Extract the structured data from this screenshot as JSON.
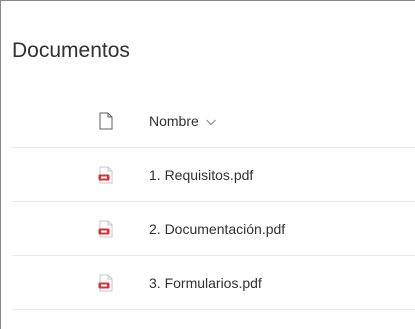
{
  "title": "Documentos",
  "header": {
    "file_type_icon": "document-icon",
    "name_label": "Nombre",
    "sort_icon": "chevron-down-icon"
  },
  "files": [
    {
      "name": "1. Requisitos.pdf",
      "icon": "pdf-icon"
    },
    {
      "name": "2. Documentación.pdf",
      "icon": "pdf-icon"
    },
    {
      "name": "3. Formularios.pdf",
      "icon": "pdf-icon"
    }
  ],
  "colors": {
    "pdf_red": "#d13438",
    "text": "#323130",
    "divider": "#edebe9"
  }
}
